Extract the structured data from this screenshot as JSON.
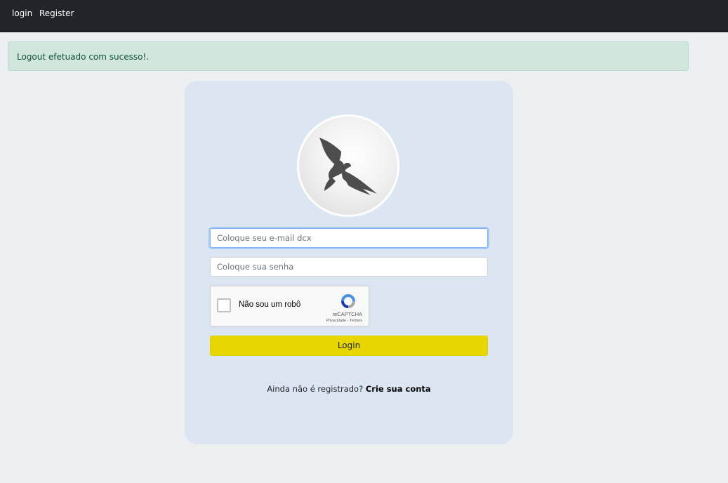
{
  "navbar": {
    "items": [
      {
        "label": "login"
      },
      {
        "label": "Register"
      }
    ],
    "background": "#212529"
  },
  "alert": {
    "message": "Logout efetuado com sucesso!.",
    "color": "#d1e7dd"
  },
  "login_card": {
    "logo_icon": "bird-icon",
    "email_placeholder": "Coloque seu e-mail dcx",
    "email_value": "",
    "password_placeholder": "Coloque sua senha",
    "password_value": "",
    "recaptcha": {
      "label": "Não sou um robô",
      "brand": "reCAPTCHA",
      "links": "Privacidade - Termos"
    },
    "login_button_label": "Login",
    "login_button_color": "#e8d700",
    "register_prompt": "Ainda não é registrado?",
    "register_link": "Crie sua conta"
  }
}
